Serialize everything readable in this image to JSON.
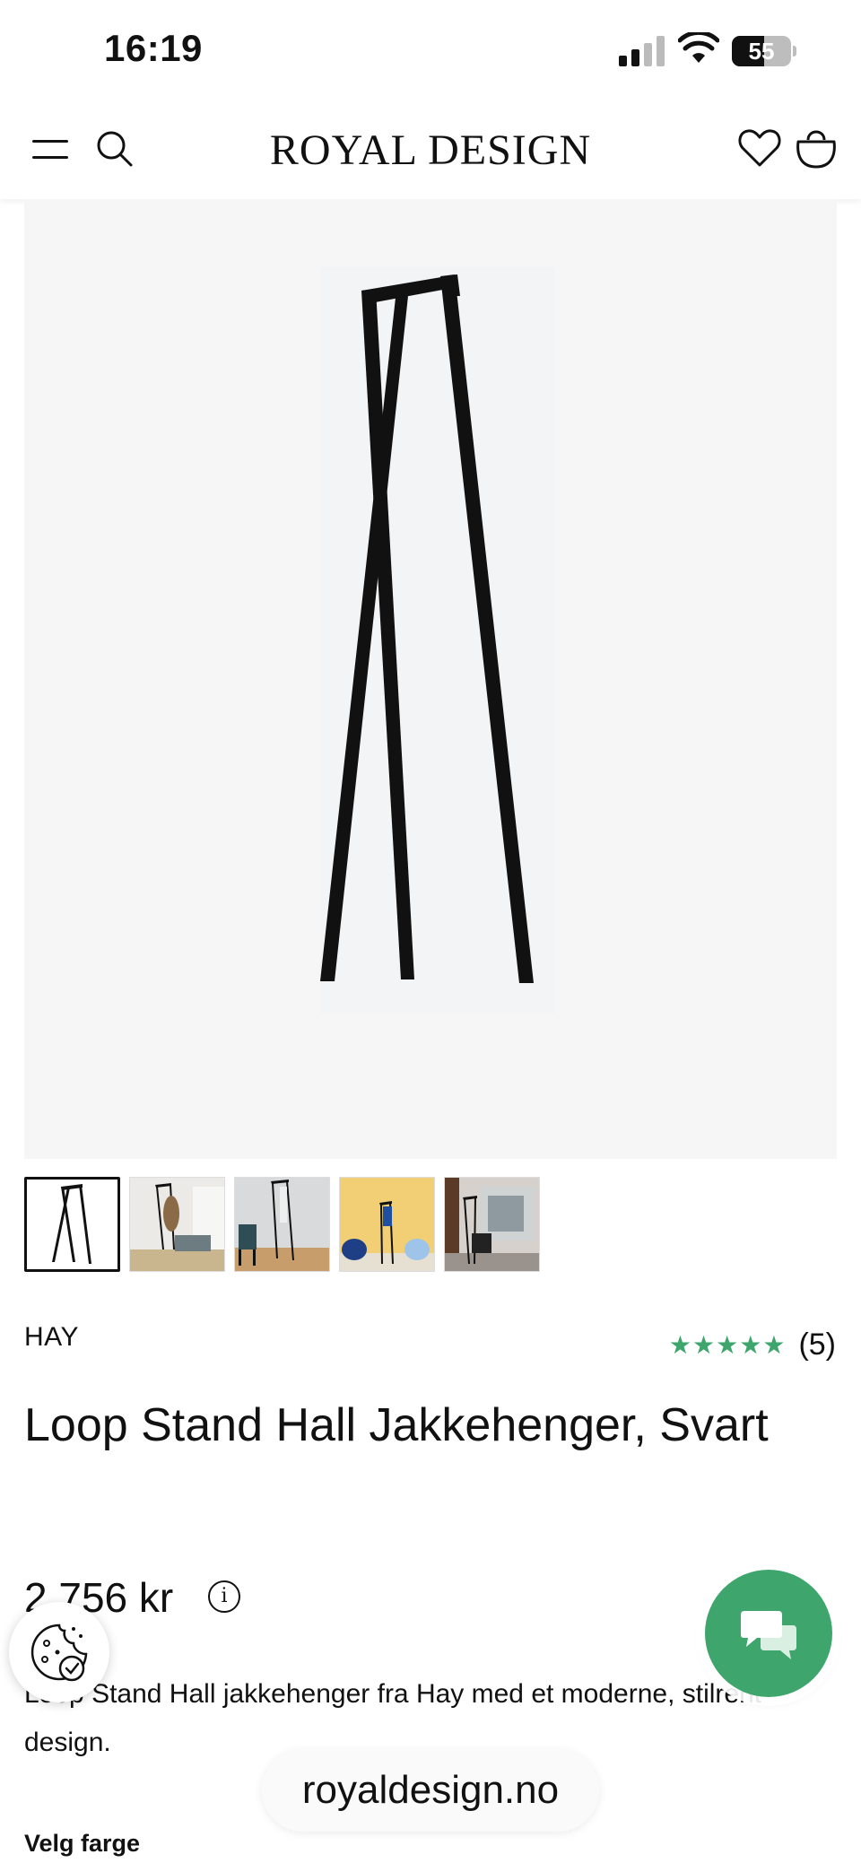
{
  "status_bar": {
    "time": "16:19",
    "battery_level": "55",
    "battery_fraction": 0.55,
    "icons": [
      "signal-icon",
      "wifi-icon",
      "battery-icon"
    ]
  },
  "header": {
    "brand": "ROYAL DESIGN",
    "icons": [
      "menu-icon",
      "search-icon",
      "heart-icon",
      "bag-icon"
    ]
  },
  "product": {
    "brand": "HAY",
    "title": "Loop Stand Hall Jakkehenger, Svart",
    "rating_count": "(5)",
    "rating_stars": 5,
    "price": "2 756 kr",
    "description": "Loop Stand Hall jakkehenger fra Hay med et moderne, stilrent design.",
    "choose_color_label": "Velg farge",
    "thumbnail_count": 5,
    "active_thumbnail": 1
  },
  "browser": {
    "url": "royaldesign.no"
  },
  "colors": {
    "accent_green": "#3ea66c",
    "image_bg": "#f6f6f7",
    "text": "#111111"
  }
}
